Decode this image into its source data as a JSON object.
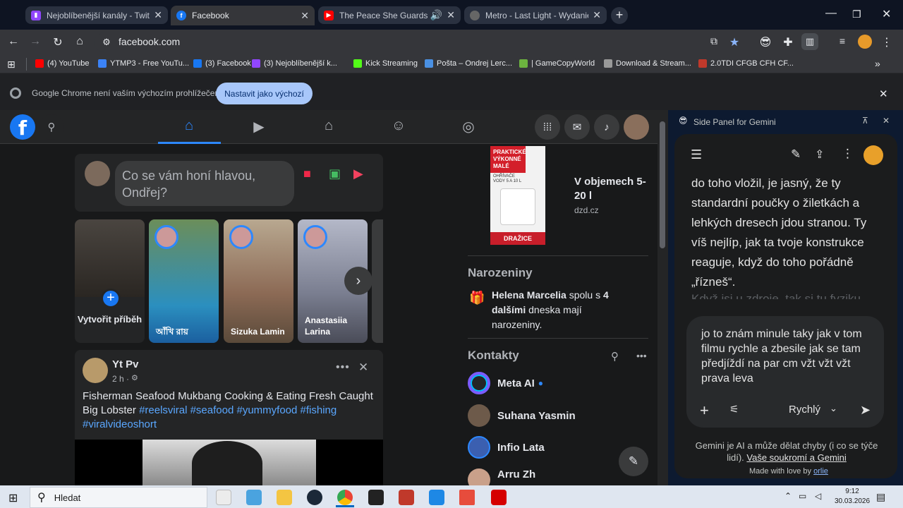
{
  "colors": {
    "fb_blue": "#1877f2",
    "accent_link": "#5aa7ff",
    "gemini_bg": "#0d1a30",
    "default_btn": "#a8c7fa"
  },
  "tabs": [
    {
      "title": "Nejoblíbenější kanály - Twitch",
      "icon": "twitch-icon",
      "color": "#9146ff"
    },
    {
      "title": "Facebook",
      "icon": "facebook-icon",
      "color": "#1877f2"
    },
    {
      "title": "The Peace She Guards | Am",
      "icon": "youtube-icon",
      "color": "#ff0000"
    },
    {
      "title": "Metro - Last Light - Wydanie K",
      "icon": "globe-icon",
      "color": "#888888"
    }
  ],
  "address": {
    "url": "facebook.com"
  },
  "bookmarks": [
    {
      "label": "(4) YouTube",
      "color": "#ff0000"
    },
    {
      "label": "YTMP3 - Free YouTu...",
      "color": "#3b82f6"
    },
    {
      "label": "(3) Facebook",
      "color": "#1877f2"
    },
    {
      "label": "(3) Nejoblíbenější k...",
      "color": "#9146ff"
    },
    {
      "label": "Kick Streaming",
      "color": "#53fc18"
    },
    {
      "label": "Pošta – Ondrej Lerc...",
      "color": "#4a90e2"
    },
    {
      "label": "| GameCopyWorld",
      "color": "#6cb33f"
    },
    {
      "label": "Download & Stream...",
      "color": "#999999"
    },
    {
      "label": "2.0TDI CFGB CFH CF...",
      "color": "#c0392b"
    }
  ],
  "infobar": {
    "text": "Google Chrome není vaším výchozím prohlížečem",
    "button": "Nastavit jako výchozí"
  },
  "composer": {
    "placeholder": "Co se vám honí hlavou, Ondřej?"
  },
  "stories": [
    {
      "name": "Vytvořit příběh"
    },
    {
      "name": "আঁখি রায়"
    },
    {
      "name": "Sizuka Lamin"
    },
    {
      "name": "Anastasiia Larina"
    }
  ],
  "post": {
    "author": "Yt Pv",
    "time": "2 h ·",
    "text": "Fisherman Seafood Mukbang Cooking & Eating Fresh Caught Big Lobster",
    "hashtags": "#reelsviral #seafood #yummyfood #fishing #viralvideoshort"
  },
  "ad": {
    "image_title": "PRAKTICKÉ VÝKONNÉ MALÉ",
    "image_sub": "OHŘÍVAČE VODY 5 A 10 L",
    "image_tag": "DRAŽICE",
    "title": "V objemech 5-20 l",
    "domain": "dzd.cz"
  },
  "birthdays": {
    "heading": "Narozeniny",
    "name": "Helena Marcelia",
    "mid": "spolu s",
    "others": "4 dalšími",
    "end": "dneska mají narozeniny."
  },
  "contacts": {
    "heading": "Kontakty",
    "items": [
      {
        "name": "Meta AI"
      },
      {
        "name": "Suhana Yasmin"
      },
      {
        "name": "Infio Lata"
      },
      {
        "name": "Arru Zh"
      }
    ]
  },
  "gemini": {
    "panel_title": "Side Panel for Gemini",
    "response": "do toho vložil, je jasný, že ty standardní poučky o žiletkách a lehkých dresech jdou stranou. Ty víš nejlíp, jak ta tvoje konstrukce reaguje, když do toho pořádně „řízneš“.",
    "response_fade": "Když jsi u zdroje, tak si tu fyziku",
    "input": "jo to znám minule taky jak v tom filmu rychle a zbesile jak se tam předjíždí na par cm vžt vžt vžt prava leva",
    "mode": "Rychlý",
    "disclaimer_a": "Gemini je AI a může dělat chyby (i co se týče lidí).",
    "disclaimer_link": "Vaše soukromí a Gemini",
    "made_with": "Made with love by",
    "made_by": "orlie"
  },
  "taskbar": {
    "search": "Hledat",
    "time": "9:12",
    "date": "30.03.2026"
  }
}
